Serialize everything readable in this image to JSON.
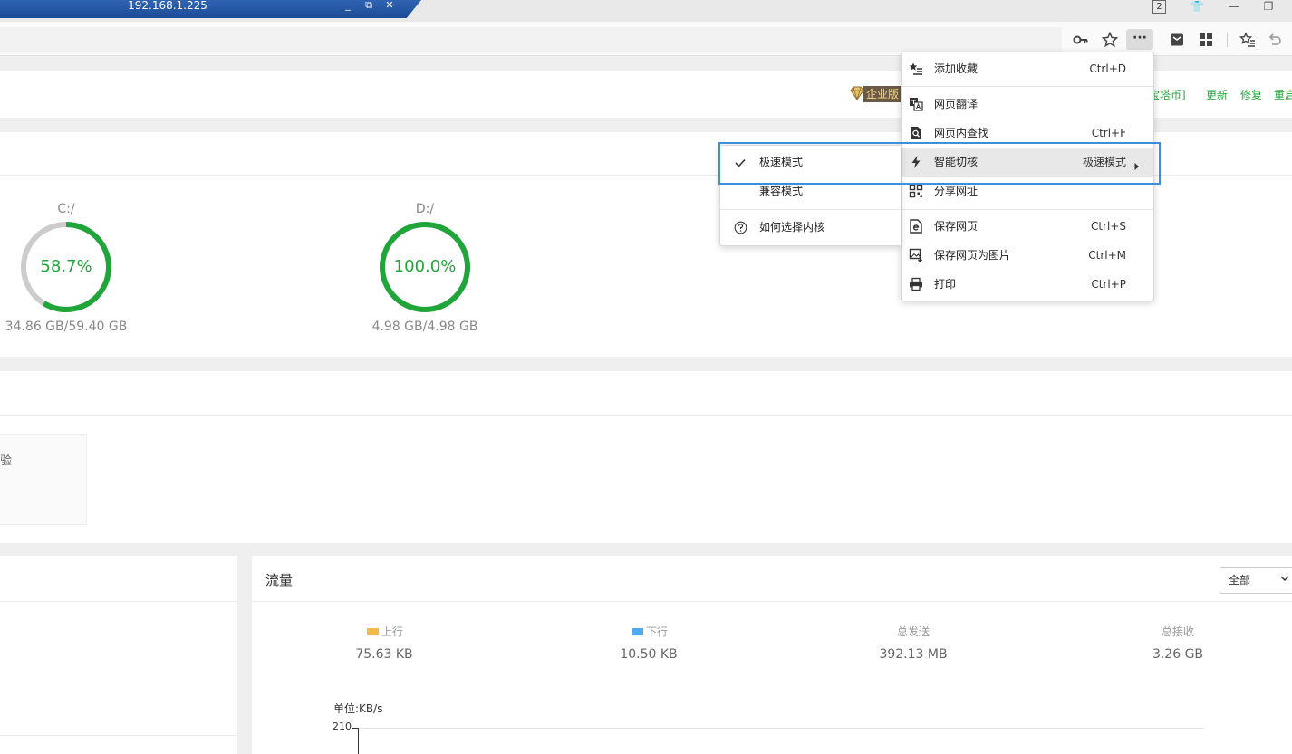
{
  "remote_window": {
    "title": "192.168.1.225",
    "minimize": "_",
    "restore": "⧉",
    "close": "✕"
  },
  "titlebar": {
    "tab_count": "2",
    "skin": "👕",
    "minimize": "—",
    "restore": "❐"
  },
  "toolbar": {
    "more": "···"
  },
  "header": {
    "edition": "企业版",
    "links": [
      "宝塔币]",
      "更新",
      "修复",
      "重启"
    ]
  },
  "disks": [
    {
      "path": "C:/",
      "percent": "58.7%",
      "fraction": 0.587,
      "usage": "34.86 GB/59.40 GB"
    },
    {
      "path": "D:/",
      "percent": "100.0%",
      "fraction": 1.0,
      "usage": "4.98 GB/4.98 GB"
    }
  ],
  "software": {
    "card_text": "验"
  },
  "traffic": {
    "title": "流量",
    "select_value": "全部",
    "stats": [
      {
        "label": "上行",
        "value": "75.63 KB",
        "color": "#f5b94a"
      },
      {
        "label": "下行",
        "value": "10.50 KB",
        "color": "#52a9f0"
      },
      {
        "label": "总发送",
        "value": "392.13 MB"
      },
      {
        "label": "总接收",
        "value": "3.26 GB"
      }
    ],
    "unit": "单位:KB/s",
    "y_tick": "210"
  },
  "menu": {
    "items": [
      {
        "label": "添加收藏",
        "shortcut": "Ctrl+D"
      },
      {
        "label": "网页翻译",
        "shortcut": ""
      },
      {
        "label": "网页内查找",
        "shortcut": "Ctrl+F"
      },
      {
        "label": "智能切核",
        "shortcut": "极速模式"
      },
      {
        "label": "分享网址",
        "shortcut": ""
      },
      {
        "label": "保存网页",
        "shortcut": "Ctrl+S"
      },
      {
        "label": "保存网页为图片",
        "shortcut": "Ctrl+M"
      },
      {
        "label": "打印",
        "shortcut": "Ctrl+P"
      }
    ]
  },
  "submenu": {
    "items": [
      {
        "label": "极速模式",
        "checked": true
      },
      {
        "label": "兼容模式",
        "checked": false
      },
      {
        "label": "如何选择内核",
        "checked": false
      }
    ]
  },
  "colors": {
    "accent_green": "#20a53a",
    "focus_blue": "#3b8fdc",
    "titlebar_blue": "#1d4b96"
  }
}
